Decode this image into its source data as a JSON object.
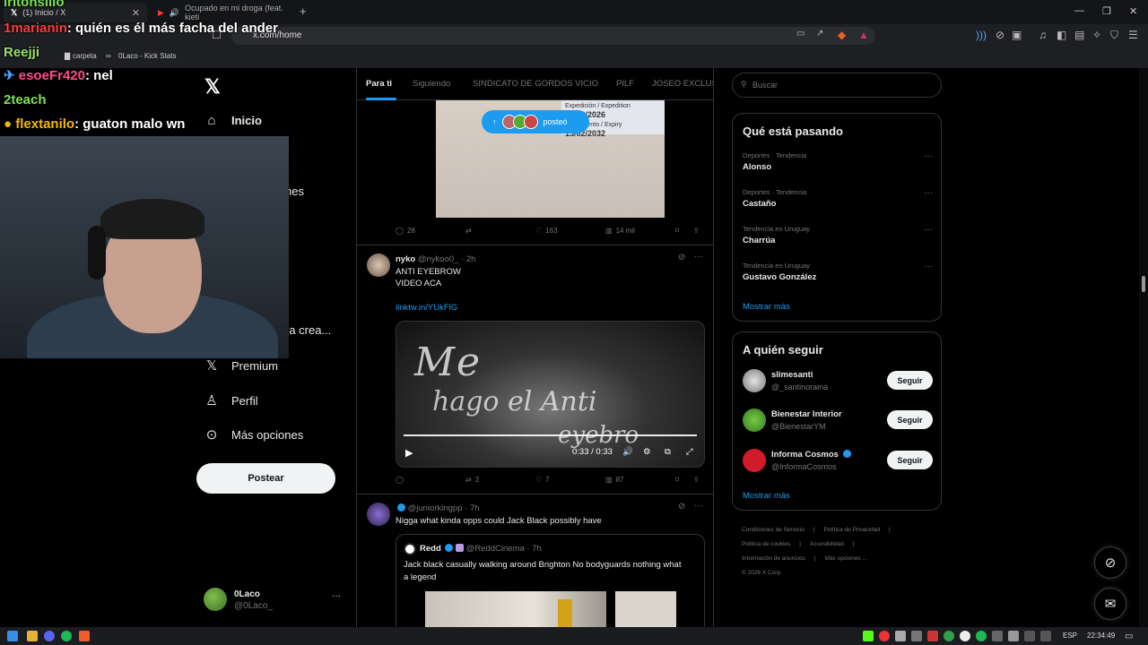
{
  "browser": {
    "tabs": [
      {
        "label": "(1) Inicio / X"
      },
      {
        "label": "Ocupado en mi droga (feat. kieti"
      }
    ],
    "new_tab": "+",
    "address": "x.com/home",
    "bookmarks": [
      "carpeta",
      "0Laco - Kick Stats"
    ]
  },
  "chat_overlay": [
    {
      "user": "iritonsilio",
      "text": ""
    },
    {
      "user": "1marianin",
      "text": ": quién es él más facha del ander"
    },
    {
      "user": "Reejji",
      "text": ""
    },
    {
      "user": "esoeFr420",
      "text": ": nel"
    },
    {
      "user": "2teach",
      "text": ":"
    },
    {
      "user": "flextanilo",
      "text": ": guaton malo wn"
    }
  ],
  "nav": {
    "items": [
      {
        "label": "Inicio",
        "icon": "home-icon"
      },
      {
        "label": "nes",
        "icon": ""
      },
      {
        "label": "ra crea...",
        "icon": ""
      },
      {
        "label": "Premium",
        "icon": "x-icon"
      },
      {
        "label": "Perfil",
        "icon": "person-icon"
      },
      {
        "label": "Más opciones",
        "icon": "more-circle-icon"
      }
    ],
    "post_button": "Postear",
    "account": {
      "name": "0Laco",
      "handle": "@0Laco_"
    }
  },
  "feed": {
    "tabs": [
      "Para ti",
      "Siguiendo",
      "SINDICATO DE GORDOS VICIO",
      "PILF",
      "JOSEO EXCLUSI"
    ],
    "new_posts_pill": "posteó",
    "id_card": {
      "issue_label": "Expedición / Expedition",
      "issue_date": "15/02/2026",
      "expiry_label": "Vencimiento / Expiry",
      "expiry_date": "15/02/2032"
    },
    "post1_actions": {
      "replies": "28",
      "reposts": "",
      "likes": "163",
      "views": "14 mil"
    },
    "post2": {
      "name": "nyko",
      "handle": "@nykoo0_",
      "time": "· 2h",
      "line1": "ANTI EYEBROW",
      "line2": "VIDEO ACA",
      "link": "linktw.in/YUkFlG",
      "video_text1": "Me",
      "video_text2": "hago el Anti",
      "video_text3": "eyebro",
      "video_time": "0:33 / 0:33",
      "actions": {
        "replies": "",
        "reposts": "2",
        "likes": "7",
        "views": "87"
      }
    },
    "post3": {
      "handle": "@juniorkingpp",
      "time": "· 7h",
      "text": "Nigga what kinda opps could Jack Black possibly have",
      "quote": {
        "name": "Redd",
        "handle": "@ReddCinema",
        "time": "· 7h",
        "line1": "Jack black casually walking around Brighton No bodyguards nothing what",
        "line2": "a legend"
      }
    }
  },
  "sidebar": {
    "search_placeholder": "Buscar",
    "trending_title": "Qué está pasando",
    "trends": [
      {
        "meta": "Deportes · Tendencia",
        "name": "Alonso"
      },
      {
        "meta": "Deportes · Tendencia",
        "name": "Castaño"
      },
      {
        "meta": "Tendencia en Uruguay",
        "name": "Charrúa"
      },
      {
        "meta": "Tendencia en Uruguay",
        "name": "Gustavo González"
      }
    ],
    "show_more": "Mostrar más",
    "follow_title": "A quién seguir",
    "follows": [
      {
        "name": "slimesanti",
        "handle": "@_santinoraina",
        "button": "Seguir"
      },
      {
        "name": "Bienestar Interior",
        "handle": "@BienestarYM",
        "button": "Seguir"
      },
      {
        "name": "Informa Cosmos",
        "handle": "@InformaCosmos",
        "button": "Seguir"
      }
    ],
    "footer": [
      "Condiciones de Servicio",
      "|",
      "Política de Privacidad",
      "|",
      "Política de cookies",
      "|",
      "Accesibilidad",
      "|",
      "Información de anuncios",
      "|",
      "Más opciones ...",
      "© 2026 X Corp."
    ]
  },
  "taskbar": {
    "lang": "ESP",
    "time": "22:34:49"
  },
  "colors": {
    "accent": "#1d9bf0",
    "background": "#000000",
    "border": "#2f3336"
  }
}
